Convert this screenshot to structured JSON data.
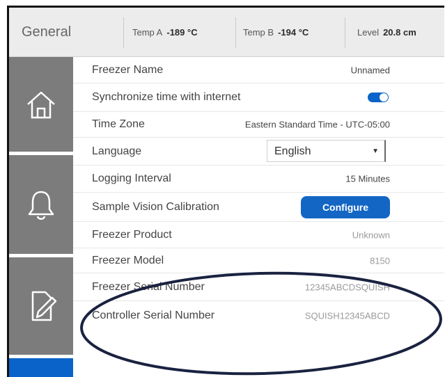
{
  "header": {
    "title": "General",
    "stats": [
      {
        "label": "Temp A",
        "value": "-189 °C"
      },
      {
        "label": "Temp B",
        "value": "-194 °C"
      },
      {
        "label": "Level",
        "value": "20.8 cm"
      }
    ]
  },
  "sidebar": {
    "items": [
      {
        "icon": "home-icon"
      },
      {
        "icon": "bell-icon"
      },
      {
        "icon": "edit-document-icon"
      },
      {
        "icon": "active-item"
      }
    ]
  },
  "settings": {
    "freezer_name": {
      "label": "Freezer Name",
      "value": "Unnamed"
    },
    "sync_time": {
      "label": "Synchronize time with internet",
      "enabled": true
    },
    "time_zone": {
      "label": "Time Zone",
      "value": "Eastern Standard Time - UTC-05:00"
    },
    "language": {
      "label": "Language",
      "value": "English"
    },
    "logging_interval": {
      "label": "Logging Interval",
      "value": "15 Minutes"
    },
    "sample_vision": {
      "label": "Sample Vision Calibration",
      "button": "Configure"
    },
    "freezer_product": {
      "label": "Freezer Product",
      "value": "Unknown"
    },
    "freezer_model": {
      "label": "Freezer Model",
      "value": "8150"
    },
    "freezer_serial": {
      "label": "Freezer Serial Number",
      "value": "12345ABCDSQUISH"
    },
    "controller_serial": {
      "label": "Controller Serial Number",
      "value": "SQUISH12345ABCD"
    }
  },
  "colors": {
    "accent": "#0a63c9",
    "sidebar": "#7c7c7c",
    "header": "#ececec",
    "annotation": "#1a2240"
  }
}
